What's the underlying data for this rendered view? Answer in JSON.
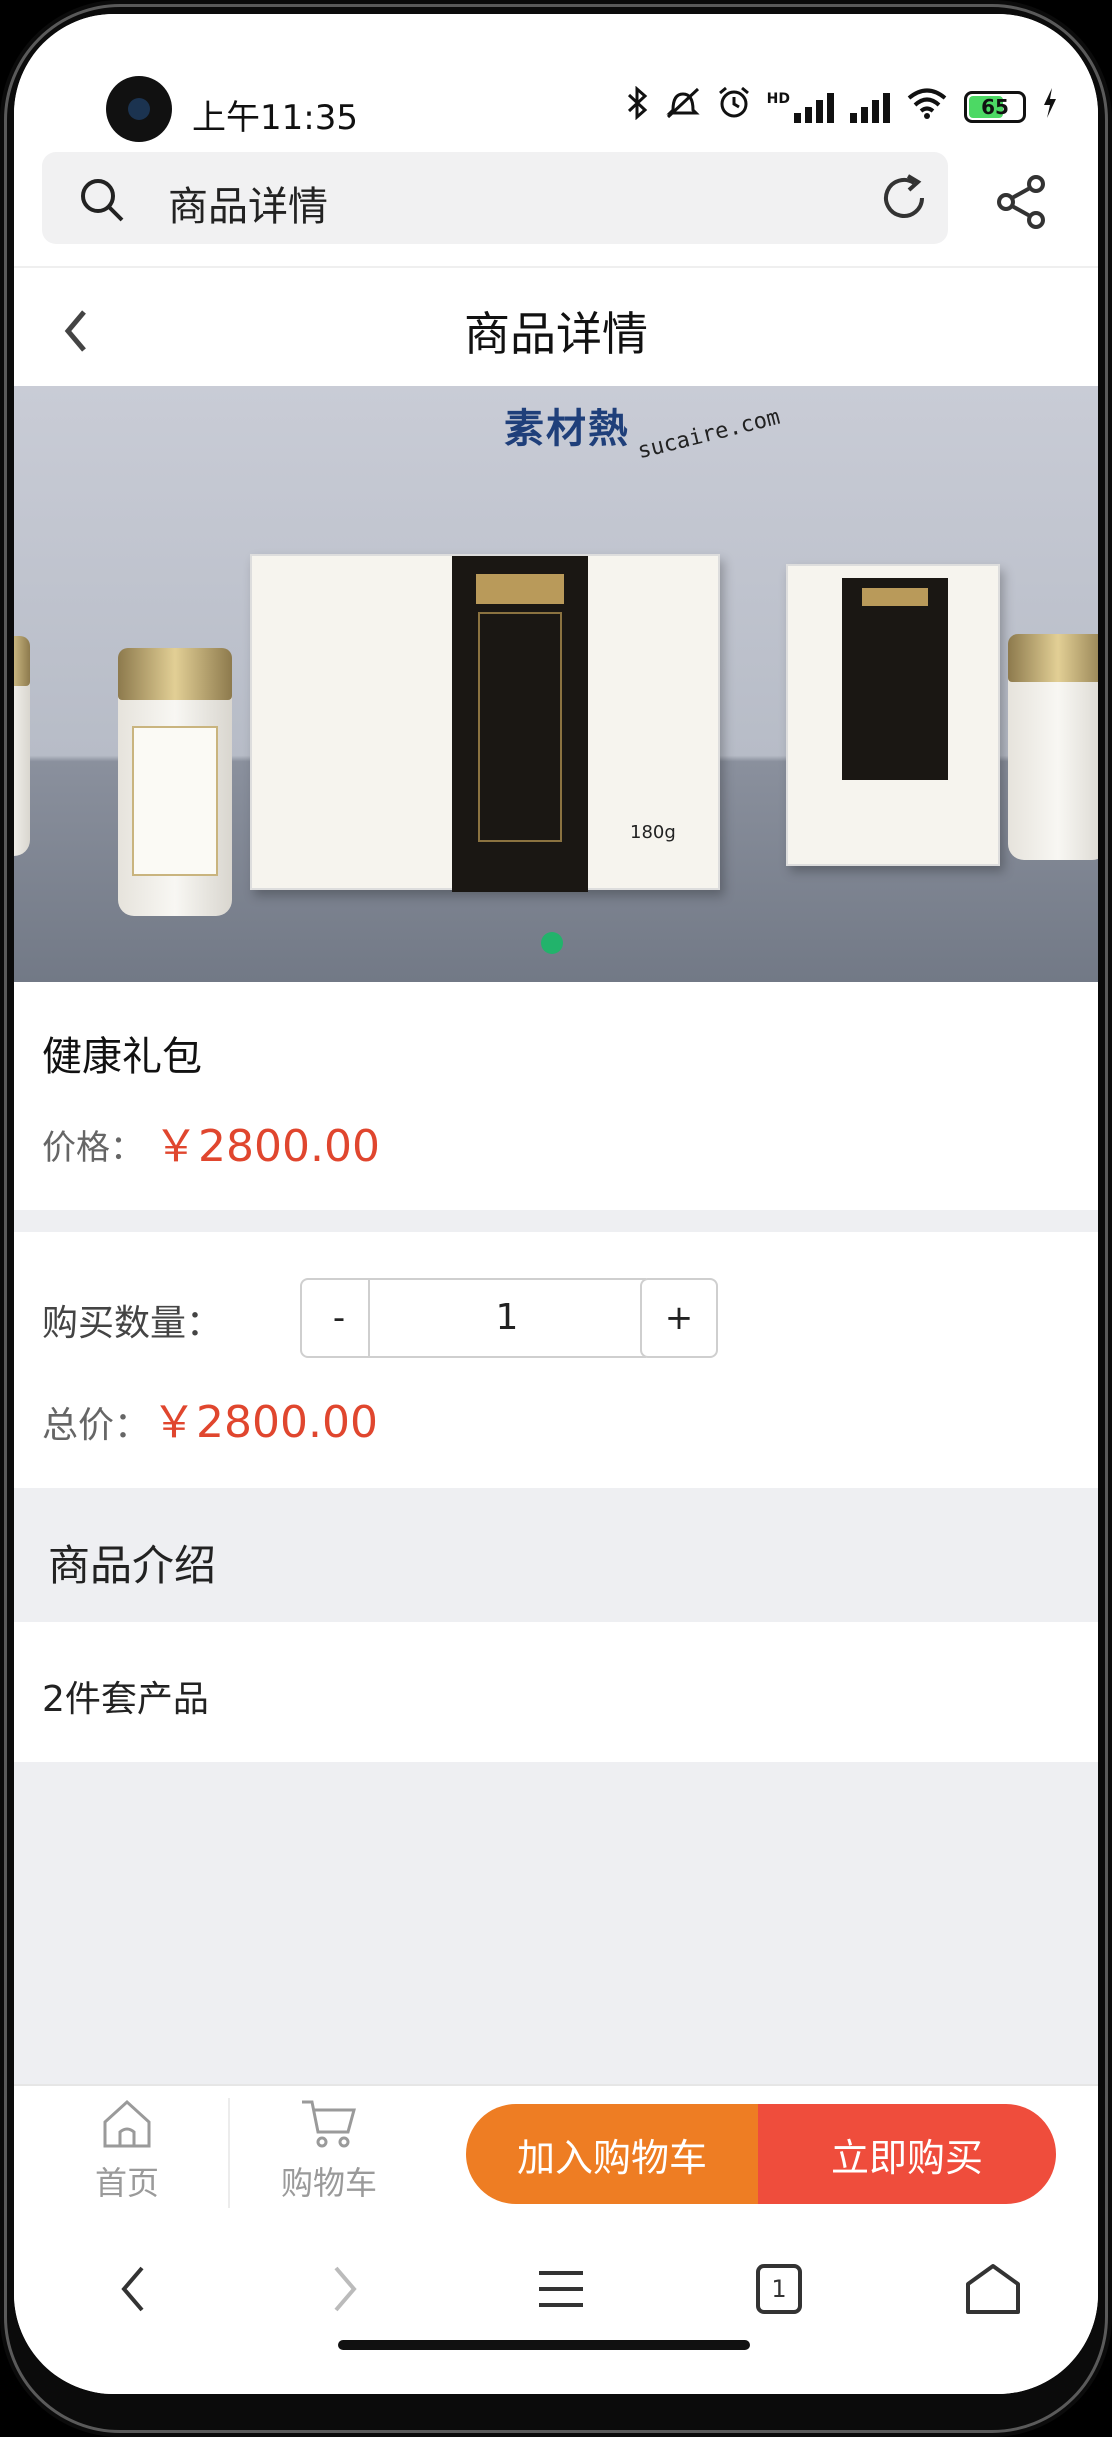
{
  "status_bar": {
    "time": "上午11:35",
    "hd_label": "HD",
    "battery_level": "65",
    "icons": [
      "bluetooth-icon",
      "mute-icon",
      "alarm-icon",
      "signal-icon",
      "signal-icon",
      "wifi-icon",
      "battery-icon",
      "charging-icon"
    ]
  },
  "browser": {
    "search_text": "商品详情"
  },
  "header": {
    "title": "商品详情"
  },
  "banner": {
    "watermark_logo": "素材熱",
    "watermark_url": "sucaire.com",
    "slide_count": 1,
    "active_slide": 1
  },
  "product": {
    "name": "健康礼包",
    "price_label": "价格：",
    "price": "￥2800.00"
  },
  "purchase": {
    "quantity_label": "购买数量：",
    "minus_label": "-",
    "quantity": "1",
    "plus_label": "+",
    "total_label": "总价：",
    "total": "￥2800.00"
  },
  "intro": {
    "title": "商品介绍",
    "text": "2件套产品"
  },
  "action_bar": {
    "home_label": "首页",
    "cart_label": "购物车",
    "add_to_cart_label": "加入购物车",
    "buy_now_label": "立即购买",
    "colors": {
      "add_to_cart": "#ee7d23",
      "buy_now": "#ef4d3c",
      "price": "#e0462e"
    }
  },
  "browser_nav": {
    "tab_count": "1"
  }
}
